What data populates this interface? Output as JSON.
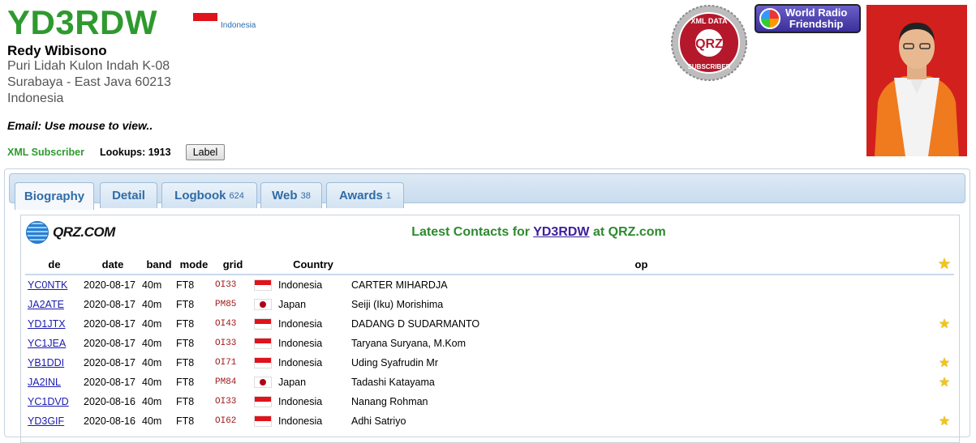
{
  "header": {
    "callsign": "YD3RDW",
    "country": "Indonesia",
    "name": "Redy Wibisono",
    "address_lines": [
      "Puri Lidah Kulon Indah K-08",
      "Surabaya - East Java 60213",
      "Indonesia"
    ],
    "email": "Email: Use mouse to view..",
    "xml_subscriber": "XML Subscriber",
    "lookups": "Lookups: 1913",
    "label_button": "Label",
    "seal_text": [
      "XML DATA",
      "QRZ",
      "SUBSCRIBER"
    ],
    "wrf_text": [
      "World Radio",
      "Friendship"
    ]
  },
  "tabs": [
    {
      "label": "Biography",
      "count": ""
    },
    {
      "label": "Detail",
      "count": ""
    },
    {
      "label": "Logbook",
      "count": "624"
    },
    {
      "label": "Web",
      "count": "38"
    },
    {
      "label": "Awards",
      "count": "1"
    }
  ],
  "contacts": {
    "logo_text": "QRZ.COM",
    "title_prefix": "Latest Contacts for ",
    "title_call": "YD3RDW",
    "title_suffix": " at QRZ.com",
    "columns": [
      "de",
      "date",
      "band",
      "mode",
      "grid",
      "",
      "Country",
      "op"
    ],
    "rows": [
      {
        "de": "YC0NTK",
        "date": "2020-08-17",
        "band": "40m",
        "mode": "FT8",
        "grid": "OI33",
        "flag": "id",
        "country": "Indonesia",
        "op": "CARTER MIHARDJA",
        "star": false
      },
      {
        "de": "JA2ATE",
        "date": "2020-08-17",
        "band": "40m",
        "mode": "FT8",
        "grid": "PM85",
        "flag": "jp",
        "country": "Japan",
        "op": "Seiji (Iku) Morishima",
        "star": false
      },
      {
        "de": "YD1JTX",
        "date": "2020-08-17",
        "band": "40m",
        "mode": "FT8",
        "grid": "OI43",
        "flag": "id",
        "country": "Indonesia",
        "op": "DADANG D SUDARMANTO",
        "star": true
      },
      {
        "de": "YC1JEA",
        "date": "2020-08-17",
        "band": "40m",
        "mode": "FT8",
        "grid": "OI33",
        "flag": "id",
        "country": "Indonesia",
        "op": "Taryana Suryana, M.Kom",
        "star": false
      },
      {
        "de": "YB1DDI",
        "date": "2020-08-17",
        "band": "40m",
        "mode": "FT8",
        "grid": "OI71",
        "flag": "id",
        "country": "Indonesia",
        "op": "Uding Syafrudin Mr",
        "star": true
      },
      {
        "de": "JA2INL",
        "date": "2020-08-17",
        "band": "40m",
        "mode": "FT8",
        "grid": "PM84",
        "flag": "jp",
        "country": "Japan",
        "op": "Tadashi Katayama",
        "star": true
      },
      {
        "de": "YC1DVD",
        "date": "2020-08-16",
        "band": "40m",
        "mode": "FT8",
        "grid": "OI33",
        "flag": "id",
        "country": "Indonesia",
        "op": "Nanang Rohman",
        "star": false
      },
      {
        "de": "YD3GIF",
        "date": "2020-08-16",
        "band": "40m",
        "mode": "FT8",
        "grid": "OI62",
        "flag": "id",
        "country": "Indonesia",
        "op": "Adhi Satriyo",
        "star": true
      }
    ]
  }
}
